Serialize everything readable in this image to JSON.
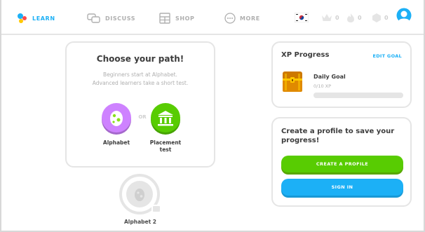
{
  "nav": {
    "learn": "LEARN",
    "discuss": "DISCUSS",
    "shop": "SHOP",
    "more": "MORE"
  },
  "stats": {
    "crowns": "0",
    "streak": "0",
    "gems": "0"
  },
  "path_card": {
    "title": "Choose your path!",
    "desc_line1": "Beginners start at Alphabet.",
    "desc_line2": "Advanced learners take a short test.",
    "or": "OR",
    "option_alphabet": "Alphabet",
    "option_test_line1": "Placement",
    "option_test_line2": "test"
  },
  "skill": {
    "label": "Alphabet 2"
  },
  "xp": {
    "title": "XP Progress",
    "edit_goal": "EDIT GOAL",
    "goal_title": "Daily Goal",
    "goal_sub": "0/10 XP",
    "progress_fraction": 0
  },
  "profile": {
    "title": "Create a profile to save your progress!",
    "create_btn": "CREATE A PROFILE",
    "signin_btn": "SIGN IN"
  },
  "colors": {
    "accent_blue": "#1cb0f6",
    "green": "#58cc02",
    "purple": "#ce82ff"
  }
}
